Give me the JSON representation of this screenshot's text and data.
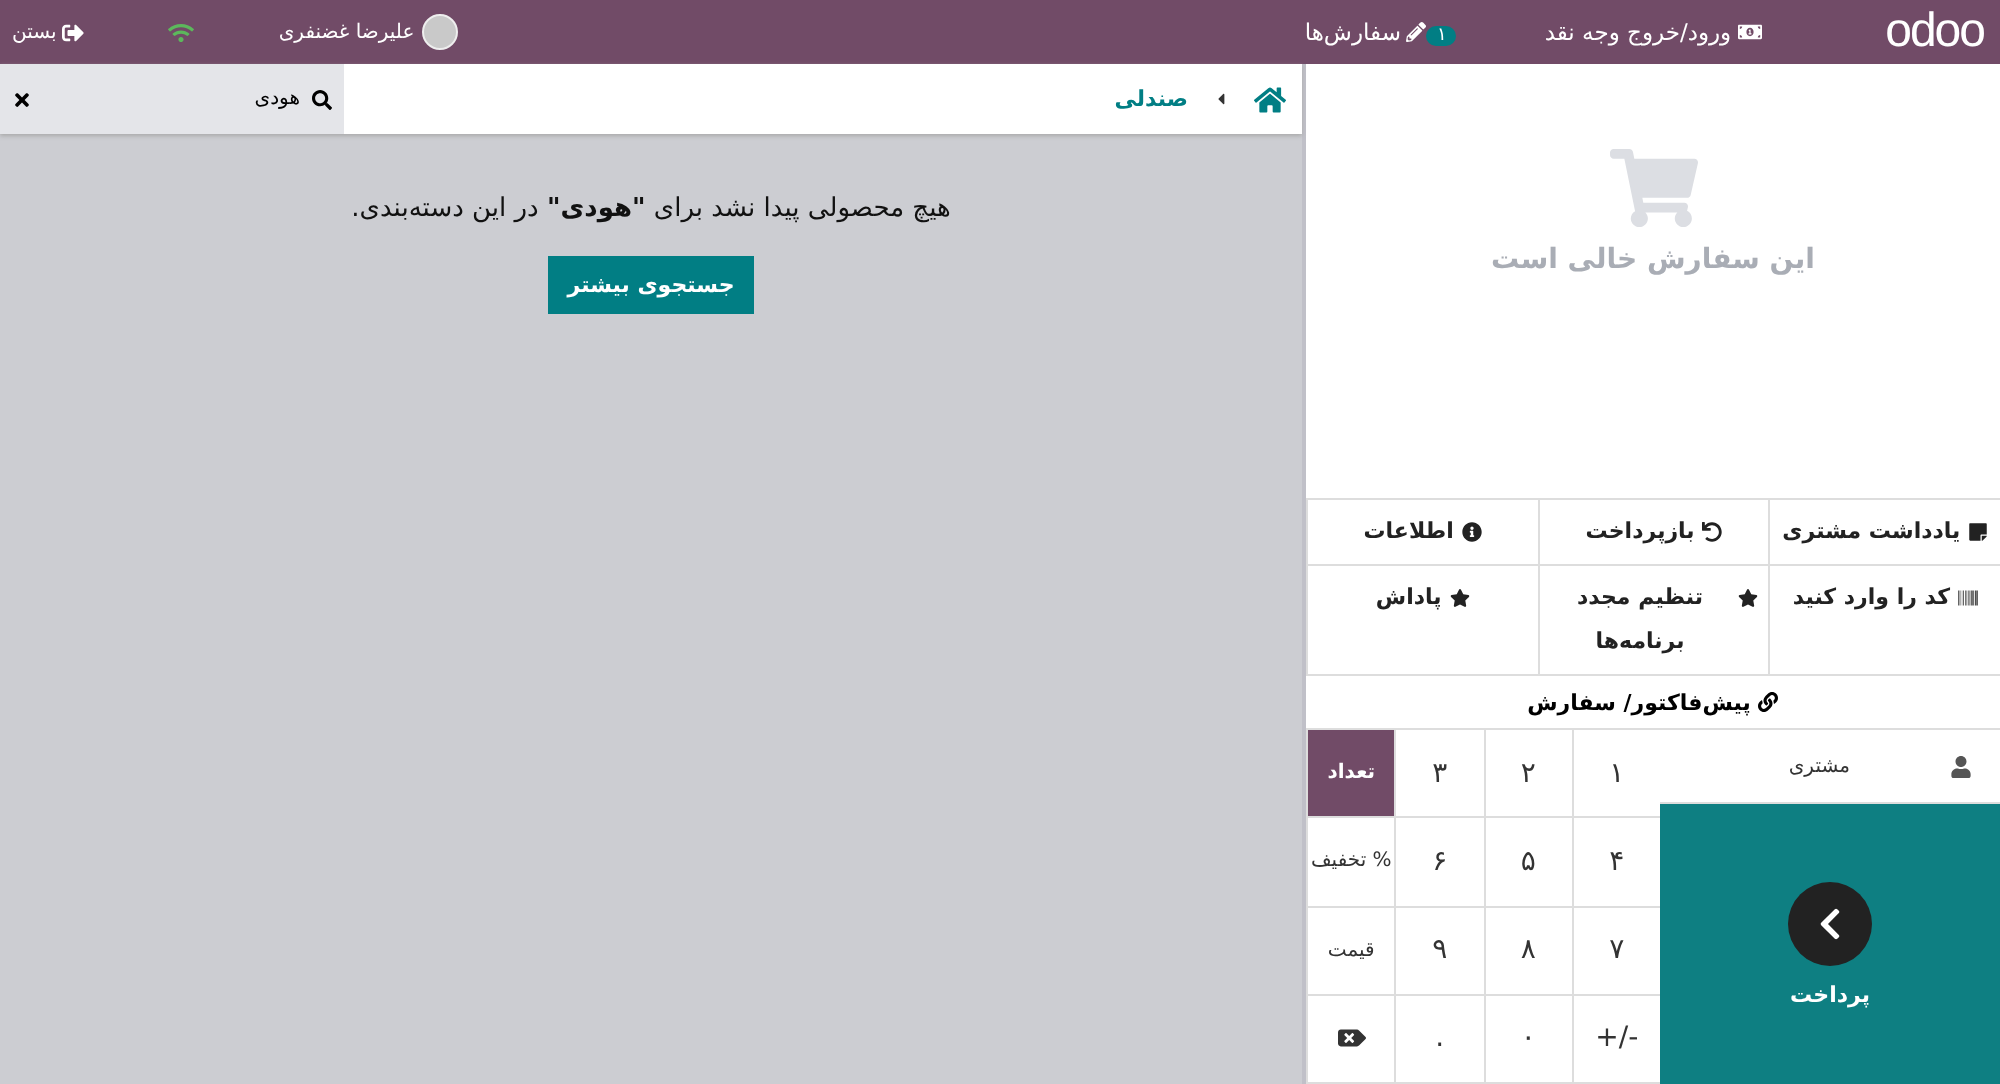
{
  "navbar": {
    "logo": "odoo",
    "cash_button": "ورود/خروج وجه نقد",
    "orders_button": {
      "label": "سفارش‌ها",
      "badge": "۱"
    },
    "user": "علیرضا غضنفری",
    "close_button": "بستن"
  },
  "breadcrumb": {
    "category": "صندلی"
  },
  "search": {
    "value": "هودی"
  },
  "no_results": {
    "message": "هیچ محصولی پیدا نشد برای **\"هودی\"** در این دسته‌بندی.",
    "button": "جستجوی بیشتر"
  },
  "order": {
    "empty_message": "این سفارش خالی است"
  },
  "control_buttons": [
    {
      "label": "یادداشت مشتری"
    },
    {
      "label": "بازپرداخت"
    },
    {
      "label": "اطلاعات"
    },
    {
      "label": "کد را وارد کنید"
    },
    {
      "label": "تنظیم مجدد برنامه‌ها"
    },
    {
      "label": "پاداش"
    }
  ],
  "quotation_button": "پیش‌فاکتور/ سفارش",
  "customer_button": "مشتری",
  "payment_button": "پرداخت",
  "numpad": [
    {
      "kind": "digit",
      "label": "۱"
    },
    {
      "kind": "digit",
      "label": "۲"
    },
    {
      "kind": "digit",
      "label": "۳"
    },
    {
      "kind": "mode",
      "label": "تعداد",
      "selected": true
    },
    {
      "kind": "digit",
      "label": "۴"
    },
    {
      "kind": "digit",
      "label": "۵"
    },
    {
      "kind": "digit",
      "label": "۶"
    },
    {
      "kind": "mode",
      "label": "% تخفیف",
      "selected": false
    },
    {
      "kind": "digit",
      "label": "۷"
    },
    {
      "kind": "digit",
      "label": "۸"
    },
    {
      "kind": "digit",
      "label": "۹"
    },
    {
      "kind": "mode",
      "label": "قیمت",
      "selected": false
    },
    {
      "kind": "digit",
      "label": "-/+"
    },
    {
      "kind": "digit",
      "label": "۰"
    },
    {
      "kind": "digit",
      "label": "."
    },
    {
      "kind": "backspace"
    }
  ]
}
